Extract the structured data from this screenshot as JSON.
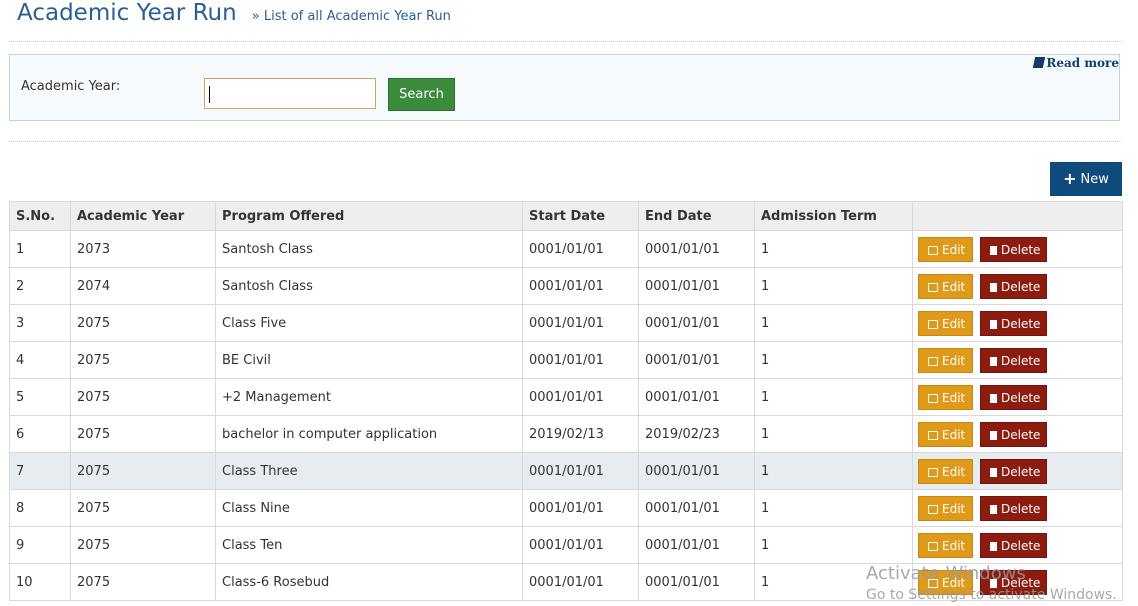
{
  "header": {
    "title": "Academic Year Run",
    "subtitle": "» List of all Academic Year Run"
  },
  "search": {
    "read_more": "Read more",
    "label": "Academic Year:",
    "input_value": "",
    "button_label": "Search"
  },
  "toolbar": {
    "new_label": "New"
  },
  "table": {
    "headers": [
      "S.No.",
      "Academic Year",
      "Program Offered",
      "Start Date",
      "End Date",
      "Admission Term",
      ""
    ],
    "edit_label": "Edit",
    "delete_label": "Delete",
    "rows": [
      {
        "sno": "1",
        "year": "2073",
        "program": "Santosh Class",
        "start": "0001/01/01",
        "end": "0001/01/01",
        "term": "1"
      },
      {
        "sno": "2",
        "year": "2074",
        "program": "Santosh Class",
        "start": "0001/01/01",
        "end": "0001/01/01",
        "term": "1"
      },
      {
        "sno": "3",
        "year": "2075",
        "program": "Class Five",
        "start": "0001/01/01",
        "end": "0001/01/01",
        "term": "1"
      },
      {
        "sno": "4",
        "year": "2075",
        "program": "BE Civil",
        "start": "0001/01/01",
        "end": "0001/01/01",
        "term": "1"
      },
      {
        "sno": "5",
        "year": "2075",
        "program": "+2 Management",
        "start": "0001/01/01",
        "end": "0001/01/01",
        "term": "1"
      },
      {
        "sno": "6",
        "year": "2075",
        "program": "bachelor in computer application",
        "start": "2019/02/13",
        "end": "2019/02/23",
        "term": "1"
      },
      {
        "sno": "7",
        "year": "2075",
        "program": "Class Three",
        "start": "0001/01/01",
        "end": "0001/01/01",
        "term": "1"
      },
      {
        "sno": "8",
        "year": "2075",
        "program": "Class Nine",
        "start": "0001/01/01",
        "end": "0001/01/01",
        "term": "1"
      },
      {
        "sno": "9",
        "year": "2075",
        "program": "Class Ten",
        "start": "0001/01/01",
        "end": "0001/01/01",
        "term": "1"
      },
      {
        "sno": "10",
        "year": "2075",
        "program": "Class-6 Rosebud",
        "start": "0001/01/01",
        "end": "0001/01/01",
        "term": "1"
      }
    ],
    "highlighted_row": 7
  },
  "watermark": {
    "line1": "Activate Windows",
    "line2": "Go to Settings to activate Windows."
  },
  "colors": {
    "title": "#2a5f96",
    "search_button": "#3c8a3c",
    "new_button": "#0f4a7d",
    "edit_button": "#df9a1a",
    "delete_button": "#8c1c10",
    "highlight_row": "#e6ecef"
  }
}
